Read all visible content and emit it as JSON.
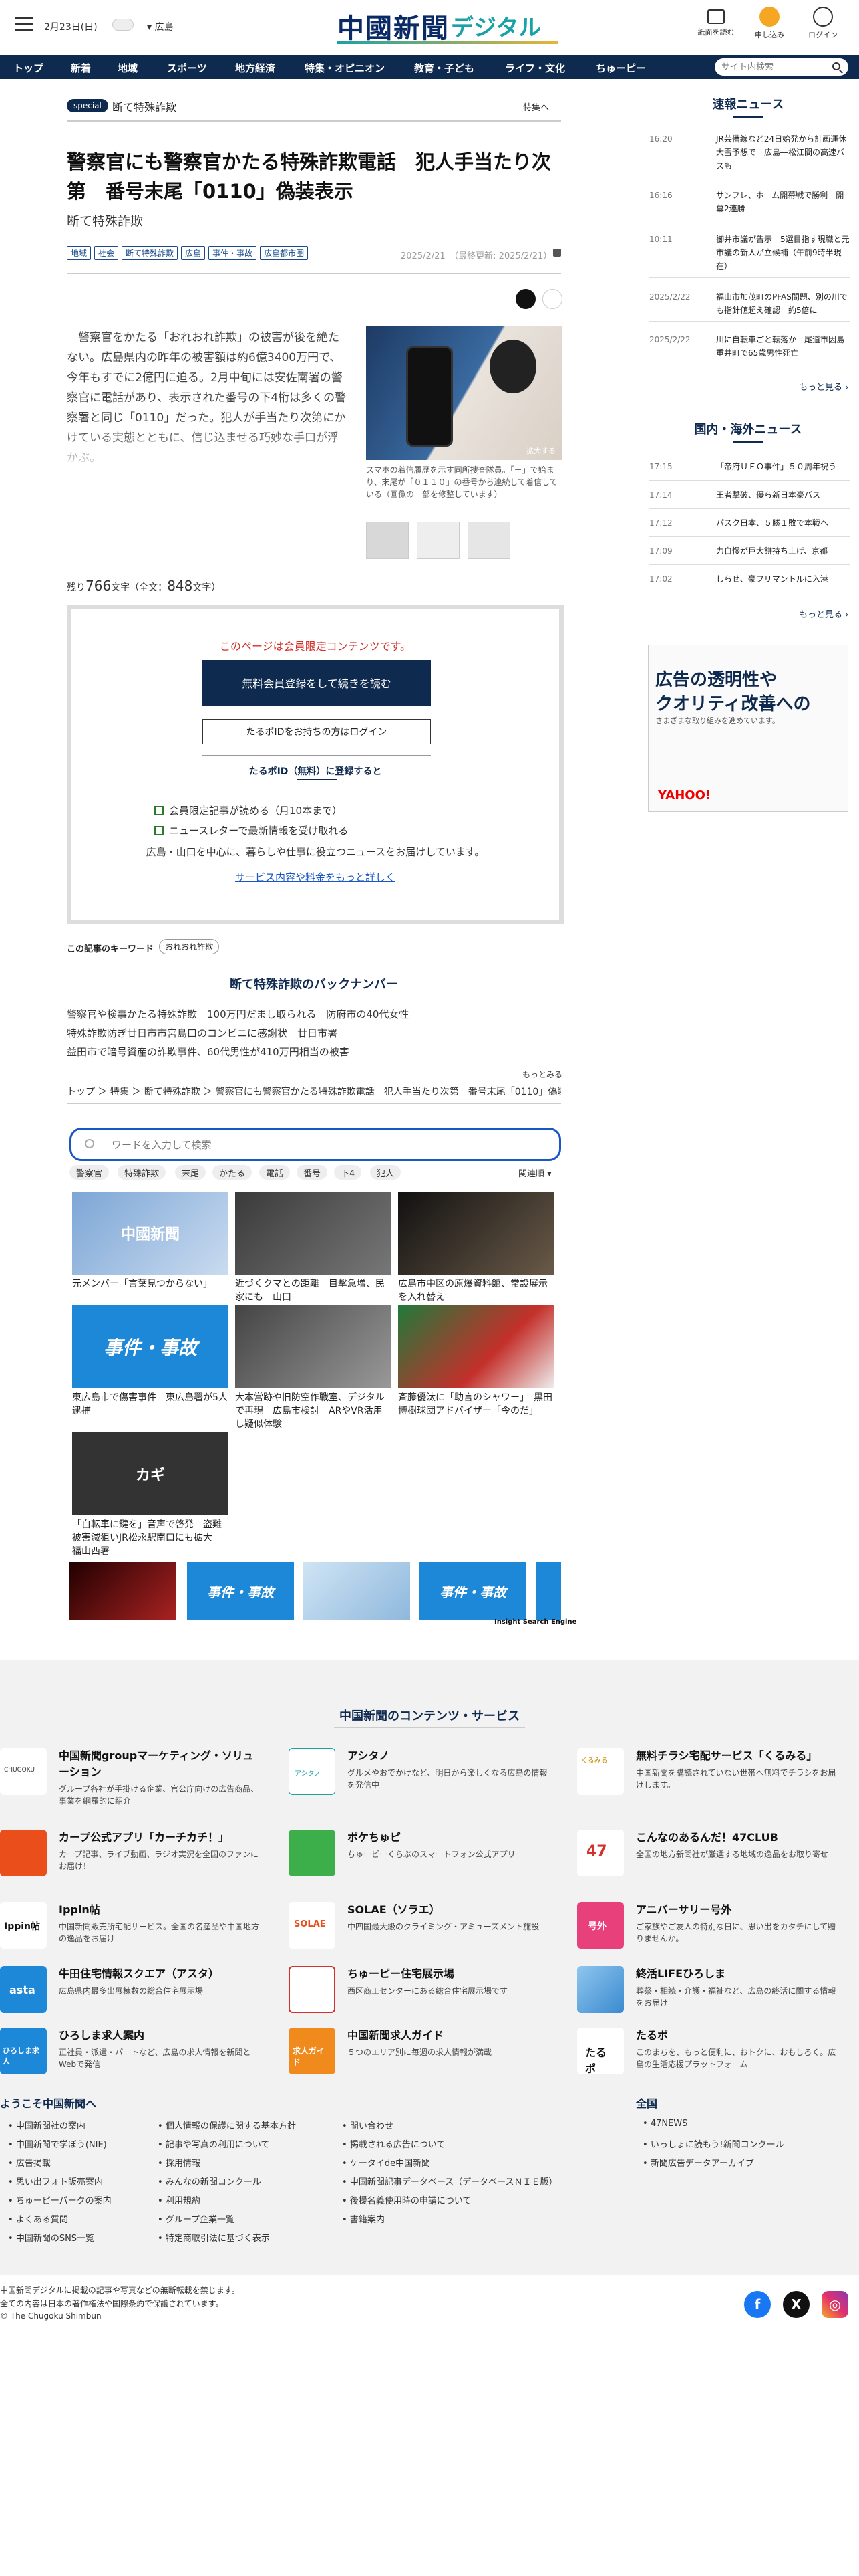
{
  "header": {
    "date": "2月23日(日)",
    "location": "広島",
    "logo_kanji": "中國新聞",
    "logo_digital": "デジタル",
    "buttons": [
      "紙面を読む",
      "申し込み",
      "ログイン"
    ]
  },
  "nav": {
    "items": [
      "トップ",
      "新着",
      "地域",
      "スポーツ",
      "地方経済",
      "特集・オピニオン",
      "教育・子ども",
      "ライフ・文化",
      "ちゅーピー"
    ],
    "search_placeholder": "サイト内検索"
  },
  "article": {
    "special_badge": "special",
    "series": "断て特殊詐欺",
    "feature_link": "特集へ",
    "title": "警察官にも警察官かたる特殊詐欺電話　犯人手当たり次第　番号末尾「0110」偽装表示",
    "subtitle": "断て特殊詐欺",
    "tags": [
      "地域",
      "社会",
      "断て特殊詐欺",
      "広島",
      "事件・事故",
      "広島都市圏"
    ],
    "date": "2025/2/21　（最終更新: 2025/2/21）",
    "body": "　警察官をかたる「おれおれ詐欺」の被害が後を絶たない。広島県内の昨年の被害額は約6億3400万円で、今年もすでに2億円に迫る。2月中旬には安佐南署の警察官に電話があり、表示された番号の下4桁は多くの警察署と同じ「0110」だった。犯人が手当たり次第にかけている実態とともに、信じ込ませる巧妙な手口が浮かぶ。",
    "photo_zoom": "拡大する",
    "photo_caption": "スマホの着信履歴を示す同所捜査隊員。「＋」で始まり、末尾が「０１１０」の番号から連続して着信している（画像の一部を修整しています）",
    "remaining_prefix": "残り",
    "remaining_count": "766",
    "remaining_suffix": "文字（全文：",
    "total_count": "848",
    "total_suffix": "文字）"
  },
  "member": {
    "notice": "このページは会員限定コンテンツです。",
    "register": "無料会員登録をして続きを読む",
    "login": "たるポIDをお持ちの方はログイン",
    "heading": "たるポID（無料）に登録すると",
    "benefits": [
      "会員限定記事が読める（月10本まで）",
      "ニュースレターで最新情報を受け取れる"
    ],
    "desc": "広島・山口を中心に、暮らしや仕事に役立つニュースをお届けしています。",
    "detail_link": "サービス内容や料金をもっと詳しく"
  },
  "keywords": {
    "label": "この記事のキーワード",
    "tags": [
      "おれおれ詐欺"
    ]
  },
  "backnumber": {
    "heading": "断て特殊詐欺のバックナンバー",
    "items": [
      "警察官や検事かたる特殊詐欺　100万円だまし取られる　防府市の40代女性",
      "特殊詐欺防ぎ廿日市市宮島口のコンビニに感謝状　廿日市署",
      "益田市で暗号資産の詐欺事件、60代男性が410万円相当の被害"
    ],
    "more": "もっとみる"
  },
  "breadcrumb": "トップ ＞ 特集 ＞ 断て特殊詐欺 ＞ 警察官にも警察官かたる特殊詐欺電話　犯人手当たり次第　番号末尾「0110」偽装表示",
  "search": {
    "placeholder": "ワードを入力して検索",
    "chips": [
      "警察官",
      "特殊詐欺",
      "末尾",
      "かたる",
      "電話",
      "番号",
      "下4",
      "犯人"
    ],
    "sort": "関連順",
    "results": [
      {
        "title": "元メンバー「言葉見つからない」",
        "label": "中國新聞"
      },
      {
        "title": "近づくクマとの距離　目撃急増、民家にも　山口",
        "label": ""
      },
      {
        "title": "広島市中区の原爆資料館、常設展示を入れ替え",
        "label": ""
      },
      {
        "title": "東広島市で傷害事件　東広島署が5人逮捕",
        "label": "事件・事故"
      },
      {
        "title": "大本営跡や旧防空作戦室、デジタルで再現　広島市検討　ARやVR活用し疑似体験",
        "label": ""
      },
      {
        "title": "斉藤優汰に「助言のシャワー」　黒田博樹球団アドバイザー「今のだ」",
        "label": ""
      },
      {
        "title": "「自転車に鍵を」音声で啓発　盗難被害減狙いJR松永駅南口にも拡大　福山西署",
        "label": "カギ"
      }
    ],
    "strip_labels": [
      "",
      "事件・事故",
      "",
      "事件・事故"
    ],
    "engine": "Insight Search Engine"
  },
  "right": {
    "breaking": {
      "heading": "速報ニュース",
      "items": [
        {
          "time": "16:20",
          "text": "JR芸備線など24日始発から計画運休　大雪予想で　広島―松江間の高速バスも"
        },
        {
          "time": "16:16",
          "text": "サンフレ、ホーム開幕戦で勝利　開幕2連勝"
        },
        {
          "time": "10:11",
          "text": "御井市議が告示　5選目指す現職と元市議の新人が立候補（午前9時半現在）"
        },
        {
          "time": "2025/2/22",
          "text": "福山市加茂町のPFAS問題、別の川でも指針値超え確認　約5倍に"
        },
        {
          "time": "2025/2/22",
          "text": "川に自転車ごと転落か　尾道市因島重井町で65歳男性死亡"
        }
      ],
      "more": "もっと見る"
    },
    "world": {
      "heading": "国内・海外ニュース",
      "items": [
        {
          "time": "17:15",
          "text": "「帝府ＵＦＯ事件」５０周年祝う"
        },
        {
          "time": "17:14",
          "text": "王者撃破、優ら新日本豪バス"
        },
        {
          "time": "17:12",
          "text": "パスク日本、５勝１敗で本戦へ"
        },
        {
          "time": "17:09",
          "text": "力自慢が巨大餅持ち上げ、京都"
        },
        {
          "time": "17:02",
          "text": "しらせ、豪フリマントルに入港"
        }
      ],
      "more": "もっと見る"
    },
    "ad": {
      "line1": "広告の透明性や",
      "line2": "クオリティ改善への",
      "line3": "さまざまな取り組みを進めています。",
      "brand": "YAHOO!"
    }
  },
  "footer": {
    "heading": "中国新聞のコンテンツ・サービス",
    "services": [
      {
        "name": "中国新聞groupマーケティング・ソリューション",
        "desc": "グループ各社が手掛ける企業、官公庁向けの広告商品、事業を網羅的に紹介"
      },
      {
        "name": "アシタノ",
        "desc": "グルメやおでかけなど、明日から楽しくなる広島の情報を発信中"
      },
      {
        "name": "無料チラシ宅配サービス「くるみる」",
        "desc": "中国新聞を購読されていない世帯へ無料でチラシをお届けします。"
      },
      {
        "name": "カープ公式アプリ「カーチカチ！」",
        "desc": "カープ記事、ライブ動画、ラジオ実況を全国のファンにお届け！"
      },
      {
        "name": "ポケちゅピ",
        "desc": "ちゅーピーくらぶのスマートフォン公式アプリ"
      },
      {
        "name": "こんなのあるんだ！47CLUB",
        "desc": "全国の地方新聞社が厳選する地域の逸品をお取り寄せ"
      },
      {
        "name": "Ippin帖",
        "desc": "中国新聞販売所宅配サービス。全国の名産品や中国地方の逸品をお届け"
      },
      {
        "name": "SOLAE（ソラエ）",
        "desc": "中四国最大級のクライミング・アミューズメント施設"
      },
      {
        "name": "アニバーサリー号外",
        "desc": "ご家族やご友人の特別な日に、思い出をカタチにして贈りませんか。"
      },
      {
        "name": "牛田住宅情報スクエア（アスタ）",
        "desc": "広島県内最多出展棟数の総合住宅展示場"
      },
      {
        "name": "ちゅーピー住宅展示場",
        "desc": "西区商工センターにある総合住宅展示場です"
      },
      {
        "name": "終活LIFEひろしま",
        "desc": "葬祭・相続・介護・福祉など、広島の終活に関する情報をお届け"
      },
      {
        "name": "ひろしま求人案内",
        "desc": "正社員・派遣・パートなど、広島の求人情報を新聞とWebで発信"
      },
      {
        "name": "中国新聞求人ガイド",
        "desc": "５つのエリア別に毎週の求人情報が満載"
      },
      {
        "name": "たるポ",
        "desc": "このまちを、もっと便利に、おトクに、おもしろく。広島の生活応援プラットフォーム"
      }
    ],
    "icon_labels": [
      "CHUGOKU",
      "アシタノ",
      "くるみる",
      "",
      "",
      "47",
      "Ippin帖",
      "SOLAE",
      "号外",
      "asta",
      "",
      "",
      "ひろしま求人",
      "求人ガイド",
      "たるポ"
    ],
    "welcome": "ようこそ中国新聞へ",
    "links_col1": [
      "中国新聞社の案内",
      "中国新聞で学ぼう(NIE)",
      "広告掲載",
      "思い出フォト販売案内",
      "ちゅーピーパークの案内",
      "よくある質問",
      "中国新聞のSNS一覧"
    ],
    "links_col2": [
      "個人情報の保護に関する基本方針",
      "記事や写真の利用について",
      "採用情報",
      "みんなの新聞コンクール",
      "利用規約",
      "グループ企業一覧",
      "特定商取引法に基づく表示"
    ],
    "links_col3": [
      "問い合わせ",
      "掲載される広告について",
      "ケータイde中国新聞",
      "中国新聞記事データベース（データベースＮＩＥ版）",
      "後援名義使用時の申請について",
      "書籍案内"
    ],
    "national": "全国",
    "links_col4": [
      "47NEWS",
      "いっしょに読もう!新聞コンクール",
      "新聞広告データアーカイブ"
    ],
    "copy1": "中国新聞デジタルに掲載の記事や写真などの無断転載を禁じます。",
    "copy2": "全ての内容は日本の著作権法や国際条約で保護されています。",
    "copy3": "© The Chugoku Shimbun"
  }
}
